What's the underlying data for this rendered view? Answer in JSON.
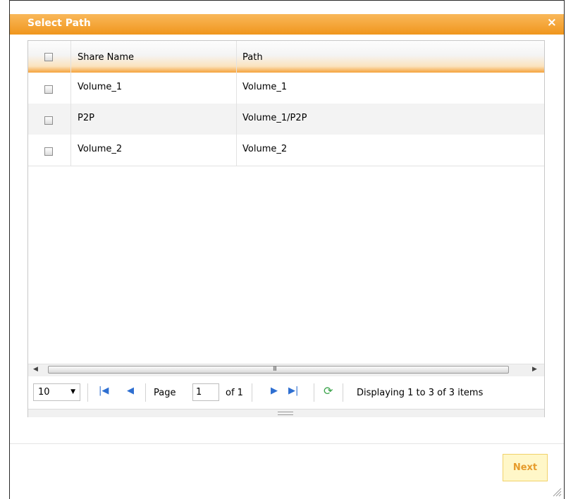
{
  "dialog": {
    "title": "Select Path",
    "close_glyph": "×"
  },
  "grid": {
    "columns": [
      "Share Name",
      "Path"
    ],
    "rows": [
      {
        "share": "Volume_1",
        "path": "Volume_1"
      },
      {
        "share": "P2P",
        "path": "Volume_1/P2P"
      },
      {
        "share": "Volume_2",
        "path": "Volume_2"
      }
    ],
    "scroll_grip": "III"
  },
  "pager": {
    "page_size": "10",
    "page_label": "Page",
    "page_value": "1",
    "of_label": "of 1",
    "status": "Displaying 1 to 3 of 3 items"
  },
  "footer": {
    "next_label": "Next"
  }
}
